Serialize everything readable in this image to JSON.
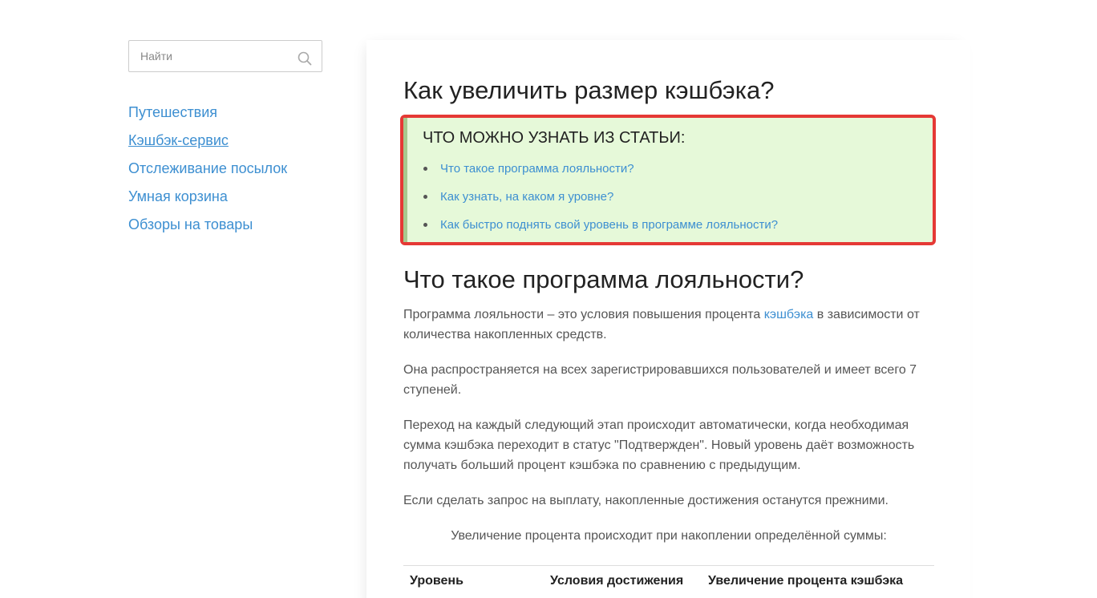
{
  "search": {
    "placeholder": "Найти"
  },
  "nav": {
    "items": [
      {
        "label": "Путешествия"
      },
      {
        "label": "Кэшбэк-сервис"
      },
      {
        "label": "Отслеживание посылок"
      },
      {
        "label": "Умная корзина"
      },
      {
        "label": "Обзоры на товары"
      }
    ]
  },
  "article": {
    "title": "Как увеличить размер кэшбэка?",
    "toc": {
      "title": "ЧТО МОЖНО УЗНАТЬ ИЗ СТАТЬИ:",
      "items": [
        {
          "label": "Что такое программа лояльности?"
        },
        {
          "label": "Как узнать, на каком я уровне?"
        },
        {
          "label": "Как быстро поднять свой уровень в программе лояльности?"
        }
      ]
    },
    "section_title": "Что такое программа лояльности?",
    "p1_before": "Программа лояльности – это условия повышения процента ",
    "p1_link": "кэшбэка",
    "p1_after": " в зависимости от количества накопленных средств.",
    "p2": "Она распространяется на всех зарегистрировавшихся пользователей и имеет всего 7 ступеней.",
    "p3": "Переход на каждый следующий этап происходит автоматически, когда необходимая сумма кэшбэка переходит в статус \"Подтвержден\". Новый уровень даёт возможность получать больший процент кэшбэка по сравнению с предыдущим.",
    "p4": "Если сделать запрос на выплату, накопленные достижения останутся прежними.",
    "p5": "Увеличение процента происходит при накоплении определённой суммы:",
    "table": {
      "headers": [
        "Уровень",
        "Условия достижения",
        "Увеличение процента кэшбэка"
      ]
    }
  },
  "colors": {
    "link": "#3d8fd1",
    "toc_border": "#e53935",
    "toc_background": "#e6f9d9"
  }
}
